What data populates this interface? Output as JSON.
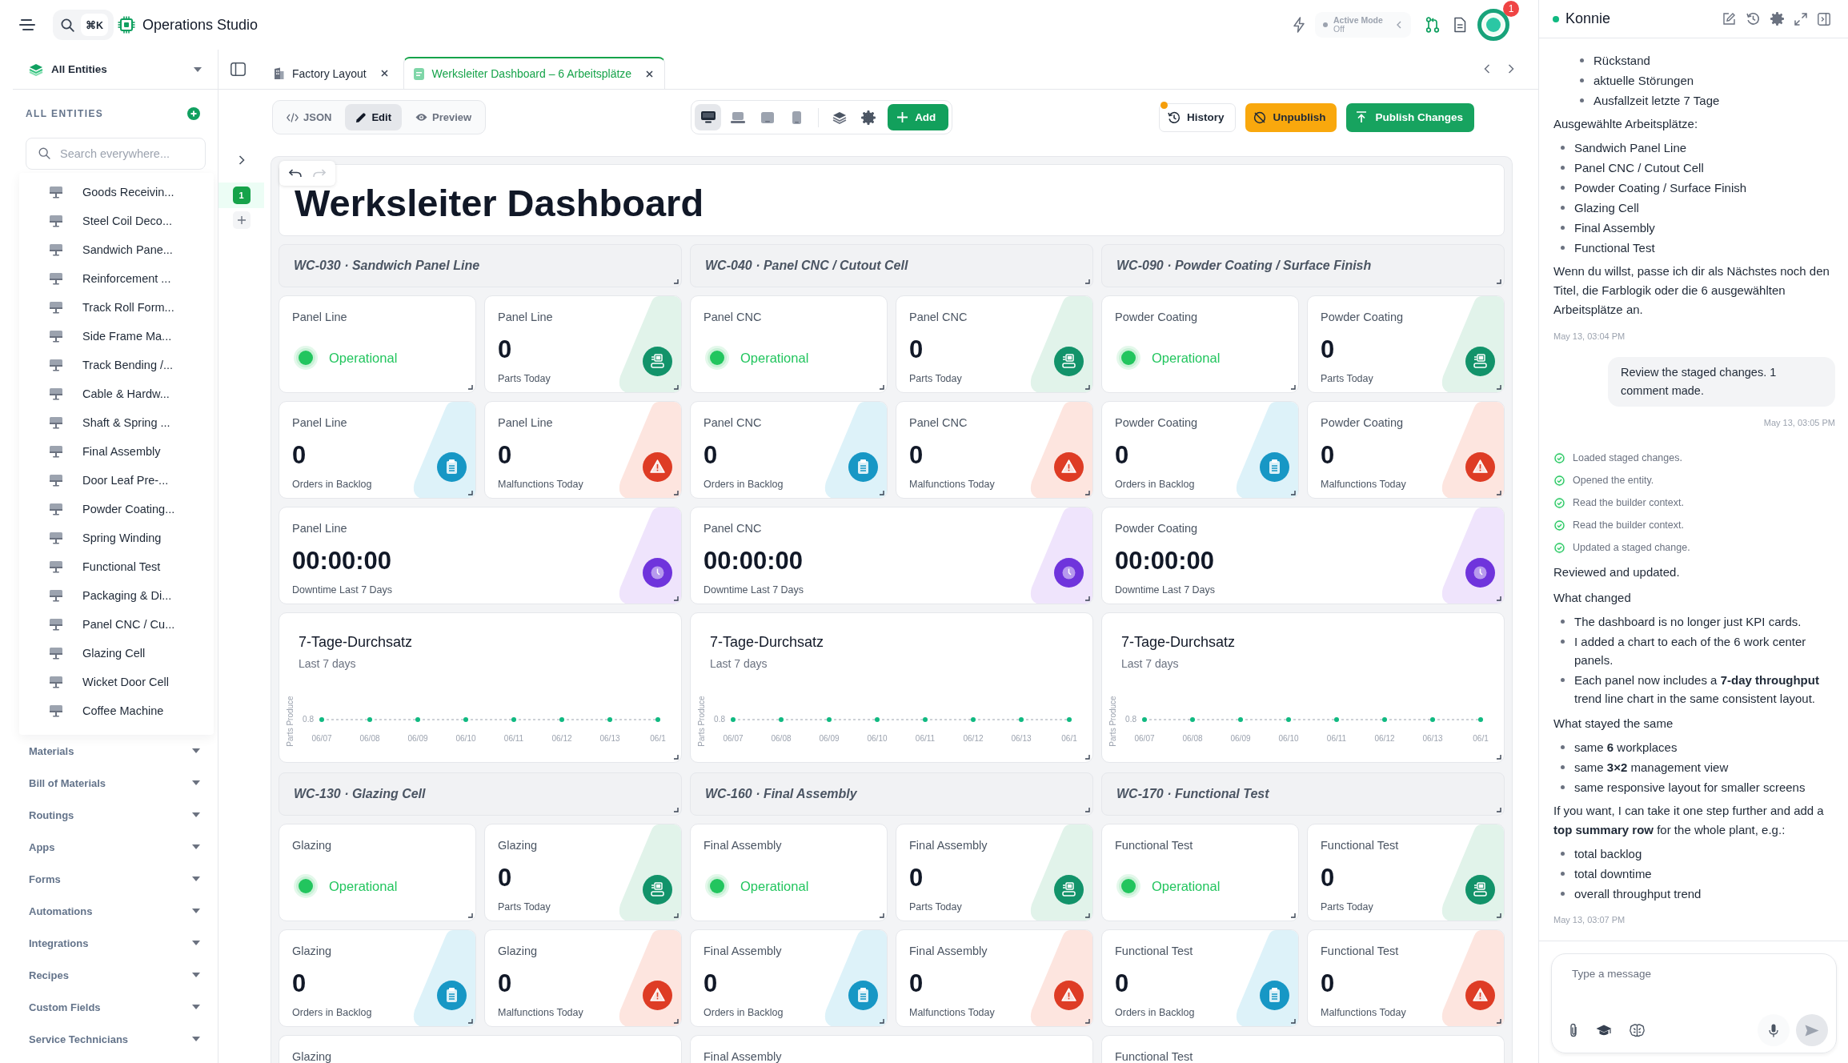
{
  "topbar": {
    "search_shortcut": "⌘K",
    "app_name": "Operations Studio",
    "active_mode": {
      "label": "Active Mode",
      "value": "Off"
    },
    "notifications": "1"
  },
  "sidebar": {
    "scope": "All Entities",
    "heading": "ALL ENTITIES",
    "search": {
      "placeholder": "Search everywhere..."
    },
    "entities": [
      "Goods Receivin...",
      "Steel Coil Deco...",
      "Sandwich Pane...",
      "Reinforcement ...",
      "Track Roll Form...",
      "Side Frame Ma...",
      "Track Bending /...",
      "Cable & Hardw...",
      "Shaft & Spring ...",
      "Final Assembly",
      "Door Leaf Pre-...",
      "Powder Coating...",
      "Spring Winding",
      "Functional Test",
      "Packaging & Di...",
      "Panel CNC / Cu...",
      "Glazing Cell",
      "Wicket Door Cell",
      "Coffee Machine"
    ],
    "groups": [
      "Materials",
      "Bill of Materials",
      "Routings",
      "Apps",
      "Forms",
      "Automations",
      "Integrations",
      "Recipes",
      "Custom Fields",
      "Service Technicians"
    ]
  },
  "rail": {
    "pages": [
      {
        "label": "1",
        "selected": true
      }
    ]
  },
  "tabs": [
    {
      "kind": "layout",
      "label": "Factory Layout",
      "selected": false
    },
    {
      "kind": "dashboard",
      "label": "Werksleiter Dashboard – 6 Arbeitsplätze",
      "selected": true
    }
  ],
  "toolbar": {
    "modes": [
      {
        "kind": "code",
        "label": "JSON",
        "selected": false
      },
      {
        "kind": "edit",
        "label": "Edit",
        "selected": true
      },
      {
        "kind": "preview",
        "label": "Preview",
        "selected": false
      }
    ],
    "devices": [
      {
        "kind": "desktop",
        "selected": true
      },
      {
        "kind": "laptop",
        "selected": false
      },
      {
        "kind": "tablet",
        "selected": false
      },
      {
        "kind": "phone",
        "selected": false
      }
    ],
    "add": "Add",
    "history": {
      "label": "History",
      "pending": true
    },
    "unpublish": "Unpublish",
    "publish": "Publish Changes"
  },
  "canvas": {
    "title": "Werksleiter Dashboard",
    "undo": {
      "disabled": false
    },
    "redo": {
      "disabled": true
    },
    "sections": [
      {
        "header": "WC-030 · Sandwich Panel Line",
        "cards": [
          {
            "kind": "status",
            "label": "Panel Line",
            "value": "Operational"
          },
          {
            "kind": "parts",
            "label": "Panel Line",
            "value": "0",
            "caption": "Parts Today"
          },
          {
            "kind": "backlog",
            "label": "Panel Line",
            "value": "0",
            "caption": "Orders in Backlog"
          },
          {
            "kind": "malfunctions",
            "label": "Panel Line",
            "value": "0",
            "caption": "Malfunctions Today"
          },
          {
            "kind": "downtime",
            "label": "Panel Line",
            "value": "00:00:00",
            "caption": "Downtime Last 7 Days"
          }
        ],
        "chart": {
          "title": "7-Tage-Durchsatz",
          "subtitle": "Last 7 days",
          "y_axis_title": "Parts Produce",
          "y_axis_value": "0.8",
          "x_labels": [
            "06/07",
            "06/08",
            "06/09",
            "06/10",
            "06/11",
            "06/12",
            "06/13",
            "06/1"
          ]
        }
      },
      {
        "header": "WC-040 · Panel CNC / Cutout Cell",
        "cards": [
          {
            "kind": "status",
            "label": "Panel CNC",
            "value": "Operational"
          },
          {
            "kind": "parts",
            "label": "Panel CNC",
            "value": "0",
            "caption": "Parts Today"
          },
          {
            "kind": "backlog",
            "label": "Panel CNC",
            "value": "0",
            "caption": "Orders in Backlog"
          },
          {
            "kind": "malfunctions",
            "label": "Panel CNC",
            "value": "0",
            "caption": "Malfunctions Today"
          },
          {
            "kind": "downtime",
            "label": "Panel CNC",
            "value": "00:00:00",
            "caption": "Downtime Last 7 Days"
          }
        ],
        "chart": {
          "title": "7-Tage-Durchsatz",
          "subtitle": "Last 7 days",
          "y_axis_title": "Parts Produce",
          "y_axis_value": "0.8",
          "x_labels": [
            "06/07",
            "06/08",
            "06/09",
            "06/10",
            "06/11",
            "06/12",
            "06/13",
            "06/1"
          ]
        }
      },
      {
        "header": "WC-090 · Powder Coating / Surface Finish",
        "cards": [
          {
            "kind": "status",
            "label": "Powder Coating",
            "value": "Operational"
          },
          {
            "kind": "parts",
            "label": "Powder Coating",
            "value": "0",
            "caption": "Parts Today"
          },
          {
            "kind": "backlog",
            "label": "Powder Coating",
            "value": "0",
            "caption": "Orders in Backlog"
          },
          {
            "kind": "malfunctions",
            "label": "Powder Coating",
            "value": "0",
            "caption": "Malfunctions Today"
          },
          {
            "kind": "downtime",
            "label": "Powder Coating",
            "value": "00:00:00",
            "caption": "Downtime Last 7 Days"
          }
        ],
        "chart": {
          "title": "7-Tage-Durchsatz",
          "subtitle": "Last 7 days",
          "y_axis_title": "Parts Produce",
          "y_axis_value": "0.8",
          "x_labels": [
            "06/07",
            "06/08",
            "06/09",
            "06/10",
            "06/11",
            "06/12",
            "06/13",
            "06/1"
          ]
        }
      },
      {
        "header": "WC-130 · Glazing Cell",
        "cards": [
          {
            "kind": "status",
            "label": "Glazing",
            "value": "Operational"
          },
          {
            "kind": "parts",
            "label": "Glazing",
            "value": "0",
            "caption": "Parts Today"
          },
          {
            "kind": "backlog",
            "label": "Glazing",
            "value": "0",
            "caption": "Orders in Backlog"
          },
          {
            "kind": "malfunctions",
            "label": "Glazing",
            "value": "0",
            "caption": "Malfunctions Today"
          },
          {
            "kind": "downtime",
            "label": "Glazing"
          }
        ]
      },
      {
        "header": "WC-160 · Final Assembly",
        "cards": [
          {
            "kind": "status",
            "label": "Final Assembly",
            "value": "Operational"
          },
          {
            "kind": "parts",
            "label": "Final Assembly",
            "value": "0",
            "caption": "Parts Today"
          },
          {
            "kind": "backlog",
            "label": "Final Assembly",
            "value": "0",
            "caption": "Orders in Backlog"
          },
          {
            "kind": "malfunctions",
            "label": "Final Assembly",
            "value": "0",
            "caption": "Malfunctions Today"
          },
          {
            "kind": "downtime",
            "label": "Final Assembly"
          }
        ]
      },
      {
        "header": "WC-170 · Functional Test",
        "cards": [
          {
            "kind": "status",
            "label": "Functional Test",
            "value": "Operational"
          },
          {
            "kind": "parts",
            "label": "Functional Test",
            "value": "0",
            "caption": "Parts Today"
          },
          {
            "kind": "backlog",
            "label": "Functional Test",
            "value": "0",
            "caption": "Orders in Backlog"
          },
          {
            "kind": "malfunctions",
            "label": "Functional Test",
            "value": "0",
            "caption": "Malfunctions Today"
          },
          {
            "kind": "downtime",
            "label": "Functional Test"
          }
        ]
      }
    ]
  },
  "chat": {
    "title": "Konnie",
    "online": true,
    "messages": [
      {
        "kind": "assistant",
        "blocks": [
          {
            "kind": "sublist",
            "items": [
              "Rückstand",
              "aktuelle Störungen",
              "Ausfallzeit letzte 7 Tage"
            ]
          },
          {
            "kind": "paragraph",
            "text": "Ausgewählte Arbeitsplätze:"
          },
          {
            "kind": "list",
            "items": [
              "Sandwich Panel Line",
              "Panel CNC / Cutout Cell",
              "Powder Coating / Surface Finish",
              "Glazing Cell",
              "Final Assembly",
              "Functional Test"
            ]
          },
          {
            "kind": "paragraph",
            "text": "Wenn du willst, passe ich dir als Nächstes noch den Titel, die Farblogik oder die 6 ausgewählten Arbeitsplätze an."
          }
        ],
        "time": "May 13, 03:04 PM"
      },
      {
        "kind": "user",
        "text": "Review the staged changes. 1 comment made.",
        "time": "May 13, 03:05 PM"
      },
      {
        "kind": "steps",
        "items": [
          {
            "text": "Loaded staged changes.",
            "done": true
          },
          {
            "text": "Opened the entity.",
            "done": true
          },
          {
            "text": "Read the builder context.",
            "done": true
          },
          {
            "text": "Read the builder context.",
            "done": true
          },
          {
            "text": "Updated a staged change.",
            "done": true
          }
        ]
      },
      {
        "kind": "assistant",
        "blocks": [
          {
            "kind": "paragraph",
            "text": "Reviewed and updated."
          },
          {
            "kind": "heading",
            "text": "What changed"
          },
          {
            "kind": "list",
            "items": [
              "The dashboard is no longer just KPI cards.",
              "I added a chart to each of the 6 work center panels.",
              "Each panel now includes a **7-day throughput** trend line chart in the same consistent layout."
            ]
          },
          {
            "kind": "heading",
            "text": "What stayed the same"
          },
          {
            "kind": "list",
            "items": [
              "same **6** workplaces",
              "same **3×2** management view",
              "same responsive layout for smaller screens"
            ]
          },
          {
            "kind": "paragraph",
            "text": "If you want, I can take it one step further and add a **top summary row** for the whole plant, e.g.:"
          },
          {
            "kind": "list",
            "items": [
              "total backlog",
              "total downtime",
              "overall throughput trend"
            ]
          }
        ],
        "time": "May 13, 03:07 PM"
      }
    ],
    "composer": {
      "placeholder": "Type a message"
    }
  }
}
